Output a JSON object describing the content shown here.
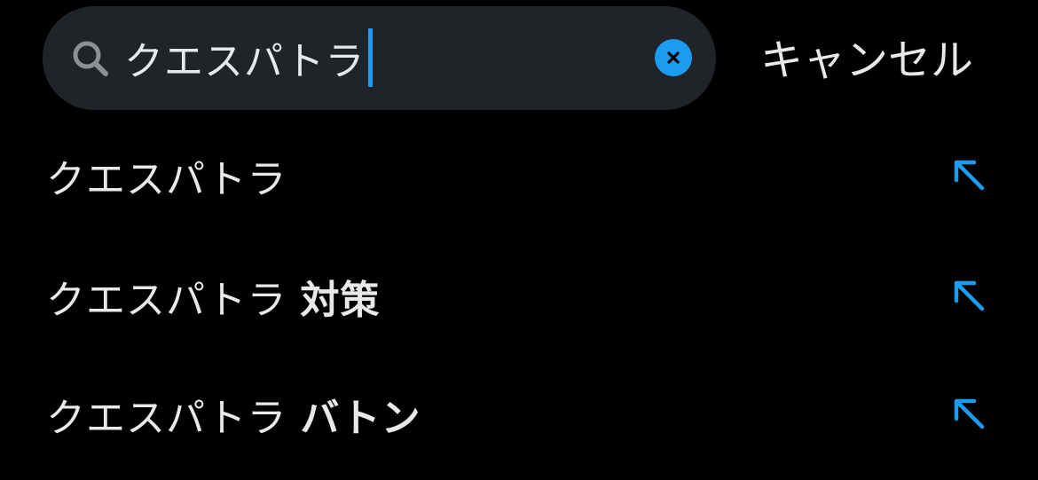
{
  "search": {
    "value": "クエスパトラ",
    "icon": "search-icon",
    "clear_icon": "clear-icon"
  },
  "cancel_label": "キャンセル",
  "suggestions": [
    {
      "prefix": "クエスパトラ",
      "suffix": ""
    },
    {
      "prefix": "クエスパトラ",
      "suffix": "対策"
    },
    {
      "prefix": "クエスパトラ",
      "suffix": "バトン"
    }
  ],
  "colors": {
    "accent": "#1d9bf0",
    "background": "#000000",
    "search_field": "#202327",
    "text": "#e7e9ea"
  }
}
